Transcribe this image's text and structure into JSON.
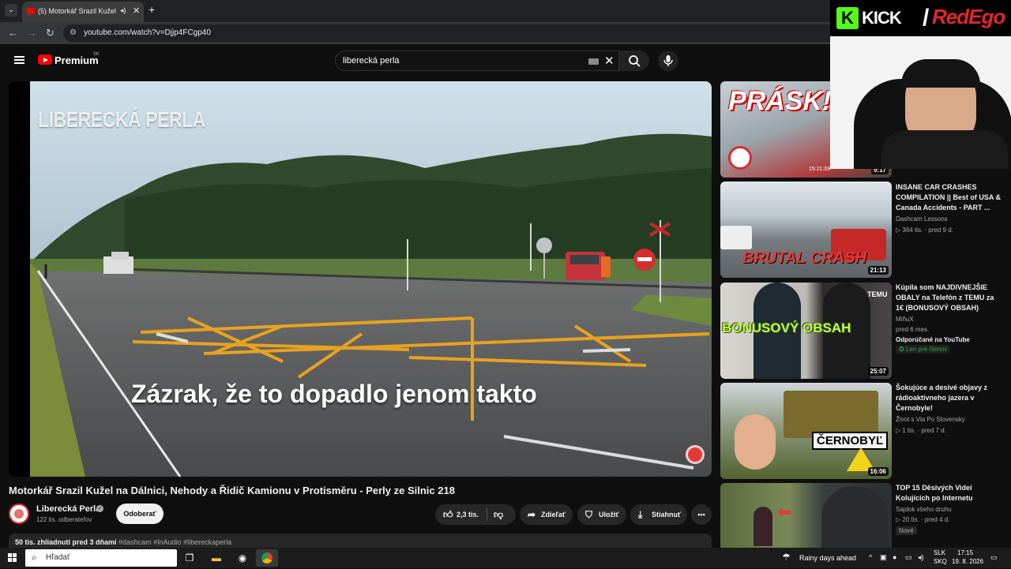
{
  "browser": {
    "tab_title": "(5) Motorkář Srazil Kužel na Dálnici",
    "url": "youtube.com/watch?v=Djjp4FCgp40"
  },
  "header": {
    "brand": "Premium",
    "country": "SK",
    "search_query": "liberecká perla"
  },
  "video": {
    "overlay_brand": "LIBERECKÁ PERLA",
    "subtitle": "Zázrak, že to dopadlo jenom takto",
    "title": "Motorkář Srazil Kužel na Dálnici, Nehody a Řidič Kamionu v Protisměru - Perly ze Silnic 218",
    "channel": "Liberecká Perla",
    "subscribers": "122 tis. odberateľov",
    "subscribe_label": "Odoberať",
    "likes": "2,3 tis.",
    "share_label": "Zdieľať",
    "save_label": "Uložiť",
    "download_label": "Stiahnuť",
    "stats": "50 tis. zhliadnutí  pred 3 dňami",
    "tags": "#dashcam #InAudio #libereckaperla"
  },
  "recommendations": [
    {
      "title": "PRÁSK!",
      "duration": "9:17",
      "thumb_text": "PRÁSK!",
      "timestamp": "15:21:09"
    },
    {
      "title": "INSANE CAR CRASHES COMPILATION  || Best of USA & Canada Accidents - PART ...",
      "channel": "Dashcam Lessons",
      "views": "364 tis.",
      "age": "pred 9 d.",
      "duration": "21:13",
      "thumb_text": "BRUTAL CRASH"
    },
    {
      "title": "Kúpila som NAJDIVNEJŠIE OBALY na Telefón z TEMU za 1€ (BONUSOVÝ OBSAH)",
      "channel": "MiňuX",
      "age": "pred 6 mes.",
      "extra": "Odporúčané na YouTube",
      "member": "Len pre členov",
      "duration": "25:07",
      "thumb_text": "BONUSOVÝ OBSAH",
      "thumb_badge": "TEMU"
    },
    {
      "title": "Šokujúce a desivé objavy z rádioaktívneho jazera v Černobyle!",
      "channel": "Život s Via Po Slovensky",
      "views": "1 tis.",
      "age": "pred 7 d.",
      "duration": "16:06",
      "thumb_text": "ČERNOBYĽ"
    },
    {
      "title": "TOP 15 Děsivých Videí Kolujících po Internetu",
      "channel": "Sajdok všeho druhu",
      "views": "20 tis.",
      "age": "pred 4 d.",
      "new": "Nové"
    }
  ],
  "stream_overlay": {
    "k": "K",
    "kick": "KICK",
    "slash": "/",
    "redego": "RedEgo"
  },
  "taskbar": {
    "search_placeholder": "Hľadať",
    "weather": "Rainy days ahead",
    "lang1": "SLK",
    "lang2": "SKQ",
    "time": "17:15",
    "date": "19. 8. 2026"
  },
  "colors": {
    "yt_red": "#ff0000",
    "kick_green": "#53fc18",
    "member_green": "#2ba640"
  }
}
